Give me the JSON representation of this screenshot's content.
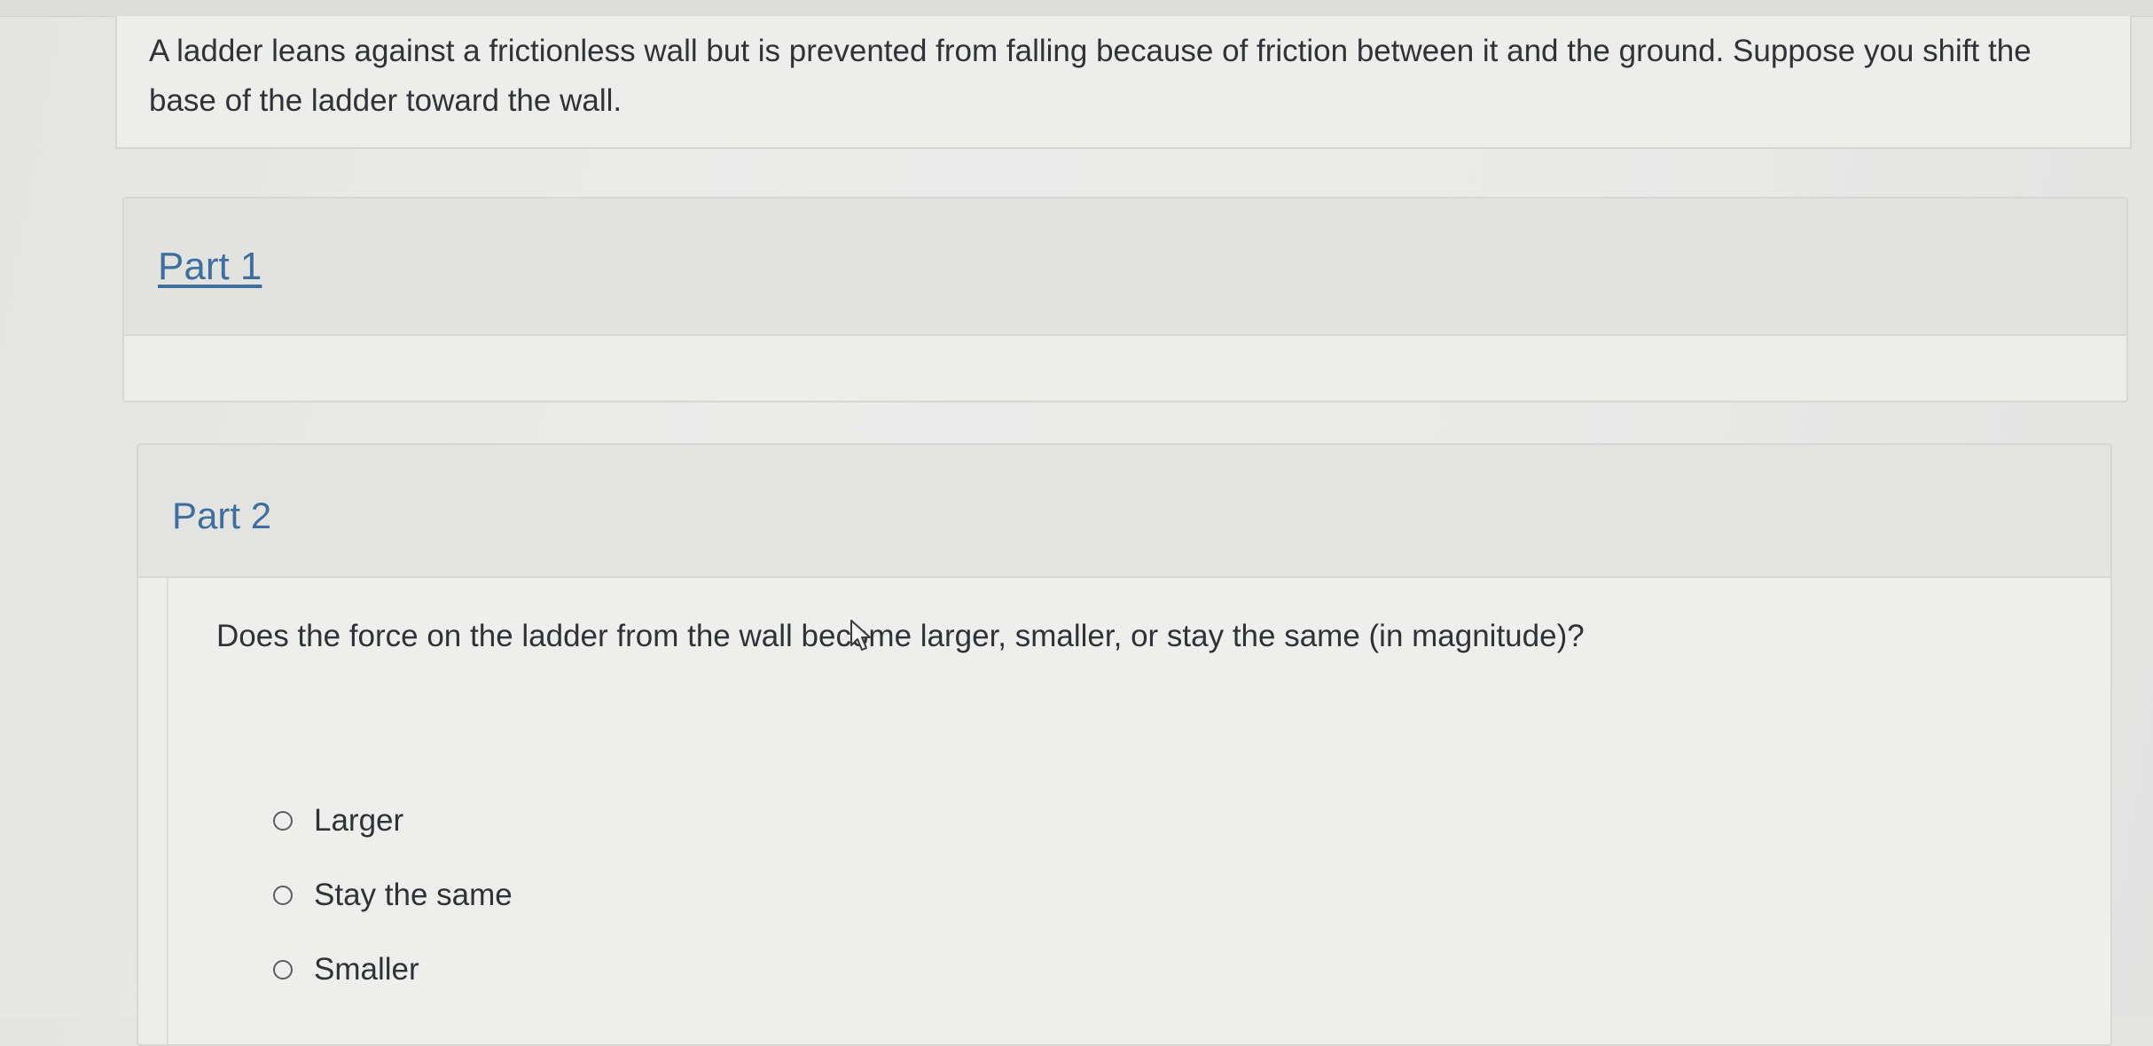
{
  "problem": {
    "text": "A ladder leans against a frictionless wall but is prevented from falling because of friction between it and the ground. Suppose you shift the base of the ladder toward the wall."
  },
  "parts": [
    {
      "title": "Part 1"
    },
    {
      "title": "Part 2",
      "question": "Does the force on the ladder from the wall become larger, smaller, or stay the same (in magnitude)?",
      "options": [
        "Larger",
        "Stay the same",
        "Smaller"
      ]
    }
  ],
  "colors": {
    "link": "#3f6f9e",
    "text": "#2f3236"
  },
  "icons": {
    "cursor": "mouse-pointer-icon",
    "radio": "radio-empty-icon"
  }
}
